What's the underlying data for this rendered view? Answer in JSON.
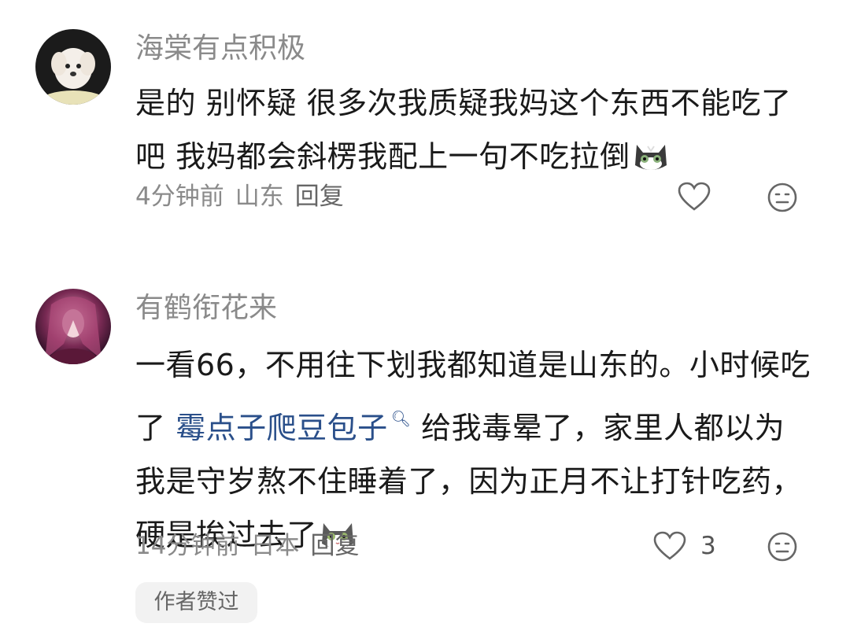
{
  "comments": [
    {
      "username": "海棠有点积极",
      "text": "是的 别怀疑 很多次我质疑我妈这个东西不能吃了吧 我妈都会斜楞我配上一句不吃拉倒",
      "time": "4分钟前",
      "location": "山东",
      "reply_label": "回复",
      "emoji_icon": "cat-sunglasses-emoji"
    },
    {
      "username": "有鹤衔花来",
      "text_before_link": "一看66，不用往下划我都知道是山东的。小时候吃了 ",
      "link_text": "霉点子爬豆包子",
      "text_after_link": " 给我毒晕了，家里人都以为我是守岁熬不住睡着了，因为正月不让打针吃药，硬是挨过去了",
      "time": "14分钟前",
      "location": "日本",
      "reply_label": "回复",
      "like_count": "3",
      "badge": "作者赞过",
      "emoji_icon": "cat-emoji"
    }
  ],
  "colors": {
    "username": "#8a8a8a",
    "link": "#2a4f8a",
    "text": "#1a1a1a"
  }
}
